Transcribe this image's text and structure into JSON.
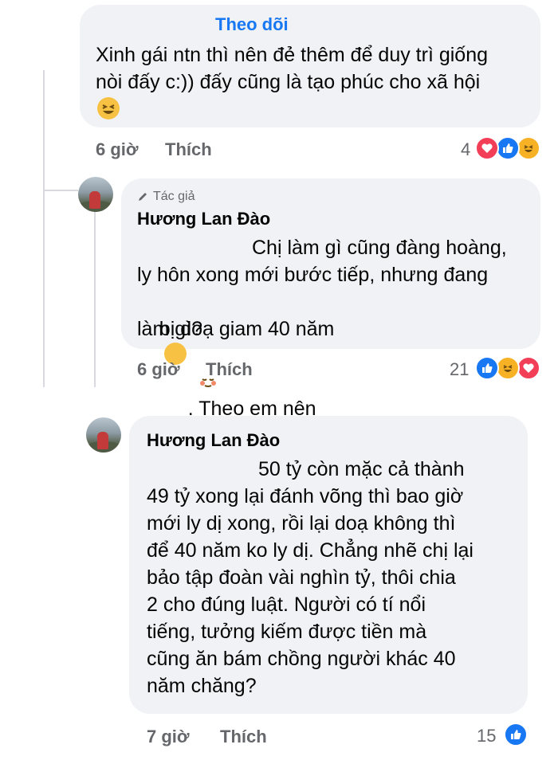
{
  "comment1": {
    "follow_label": "Theo dõi",
    "text_line1": "Xinh gái ntn thì nên đẻ thêm để duy trì giống",
    "text_line2": "nòi đấy c:)) đấy cũng là tạo phúc cho xã hội",
    "time": "6 giờ",
    "like_label": "Thích",
    "reaction_count": "4",
    "reactions": [
      "love",
      "like",
      "haha"
    ]
  },
  "reply1": {
    "author_badge": "Tác giả",
    "name": "Hương Lan Đào",
    "text_lines": [
      "Chị làm gì cũng đàng hoàng,",
      "ly hôn xong mới bước tiếp, nhưng đang",
      "bị doạ giam 40 năm",
      ". Theo em nên",
      "làm gì?"
    ],
    "time": "6 giờ",
    "like_label": "Thích",
    "reaction_count": "21",
    "reactions": [
      "like",
      "haha",
      "love"
    ]
  },
  "comment2": {
    "name": "Hương Lan Đào",
    "text_lines": [
      "50 tỷ còn mặc cả thành",
      "49 tỷ xong lại đánh võng thì bao giờ",
      "mới ly dị xong, rồi lại doạ không thì",
      "để 40 năm ko ly dị. Chẳng nhẽ chị lại",
      "bảo tập đoàn vài nghìn tỷ, thôi chia",
      "2 cho đúng luật. Người có tí nổi",
      "tiếng, tưởng kiếm được tiền mà",
      "cũng ăn bám chồng người khác 40",
      "năm chăng?"
    ],
    "time": "7 giờ",
    "like_label": "Thích",
    "reaction_count": "15",
    "reactions": [
      "like"
    ]
  },
  "colors": {
    "bubble": "#f0f2f5",
    "link_blue": "#1877f2",
    "meta_gray": "#65676b",
    "love": "#f33e58",
    "like": "#1877f2",
    "haha": "#f7b125"
  }
}
